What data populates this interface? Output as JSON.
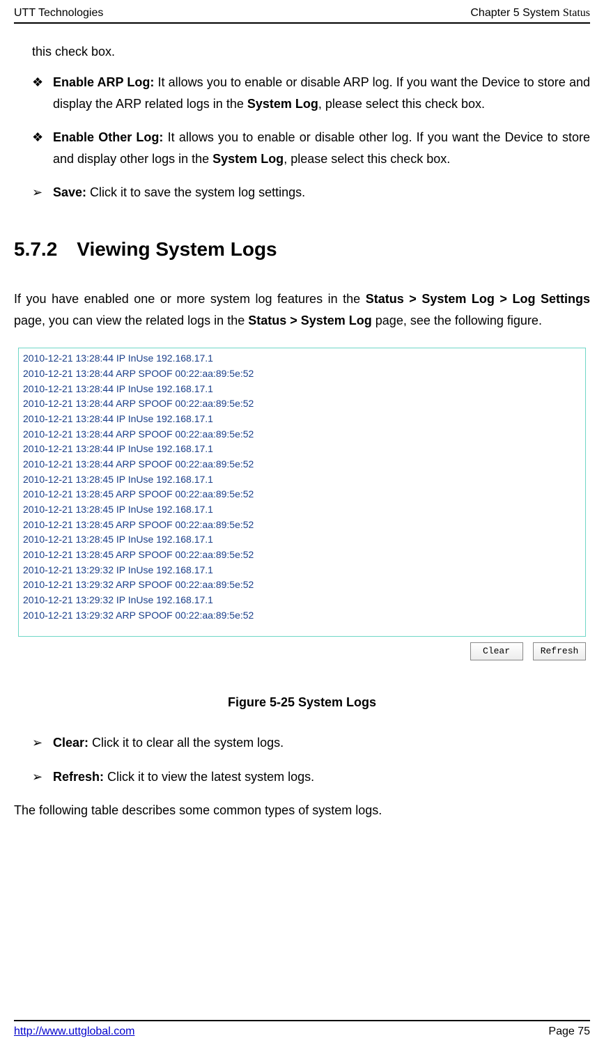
{
  "header": {
    "left": "UTT Technologies",
    "right_prefix": "Chapter 5 System ",
    "right_suffix": "Status"
  },
  "lead": "this check box.",
  "items": [
    {
      "mark": "❖",
      "bold": "Enable ARP Log: ",
      "text_a": "It allows you to enable or disable ARP log. If you want the Device to store and display the ARP related logs in the ",
      "bold2": "System Log",
      "text_b": ", please select this check box."
    },
    {
      "mark": "❖",
      "bold": "Enable Other Log: ",
      "text_a": "It allows you to enable or disable other log. If you want the Device to store and display other logs in the ",
      "bold2": "System Log",
      "text_b": ", please select this check box."
    },
    {
      "mark": "➢",
      "bold": "Save: ",
      "text_a": "Click it to save the system log settings.",
      "bold2": "",
      "text_b": ""
    }
  ],
  "section_heading": "5.7.2 Viewing System Logs",
  "para_parts": {
    "a": "If you have enabled one or more system log features in the ",
    "b": "Status > System Log > Log Settings",
    "c": " page, you can view the related logs in the ",
    "d": "Status > System Log",
    "e": " page, see the following figure."
  },
  "log_lines": [
    "2010-12-21 13:28:44 IP InUse 192.168.17.1",
    "2010-12-21 13:28:44 ARP SPOOF 00:22:aa:89:5e:52",
    "2010-12-21 13:28:44 IP InUse 192.168.17.1",
    "2010-12-21 13:28:44 ARP SPOOF 00:22:aa:89:5e:52",
    "2010-12-21 13:28:44 IP InUse 192.168.17.1",
    "2010-12-21 13:28:44 ARP SPOOF 00:22:aa:89:5e:52",
    "2010-12-21 13:28:44 IP InUse 192.168.17.1",
    "2010-12-21 13:28:44 ARP SPOOF 00:22:aa:89:5e:52",
    "2010-12-21 13:28:45 IP InUse 192.168.17.1",
    "2010-12-21 13:28:45 ARP SPOOF 00:22:aa:89:5e:52",
    "2010-12-21 13:28:45 IP InUse 192.168.17.1",
    "2010-12-21 13:28:45 ARP SPOOF 00:22:aa:89:5e:52",
    "2010-12-21 13:28:45 IP InUse 192.168.17.1",
    "2010-12-21 13:28:45 ARP SPOOF 00:22:aa:89:5e:52",
    "2010-12-21 13:29:32 IP InUse 192.168.17.1",
    "2010-12-21 13:29:32 ARP SPOOF 00:22:aa:89:5e:52",
    "2010-12-21 13:29:32 IP InUse 192.168.17.1",
    "2010-12-21 13:29:32 ARP SPOOF 00:22:aa:89:5e:52"
  ],
  "buttons": {
    "clear": "Clear",
    "refresh": "Refresh"
  },
  "fig_caption": "Figure 5-25 System Logs",
  "items2": [
    {
      "mark": "➢",
      "bold": "Clear: ",
      "text": "Click it to clear all the system logs."
    },
    {
      "mark": "➢",
      "bold": "Refresh: ",
      "text": "Click it to view the latest system logs."
    }
  ],
  "trailing_para": "The following table describes some common types of system logs.",
  "footer": {
    "url": "http://www.uttglobal.com",
    "page": "Page 75"
  }
}
